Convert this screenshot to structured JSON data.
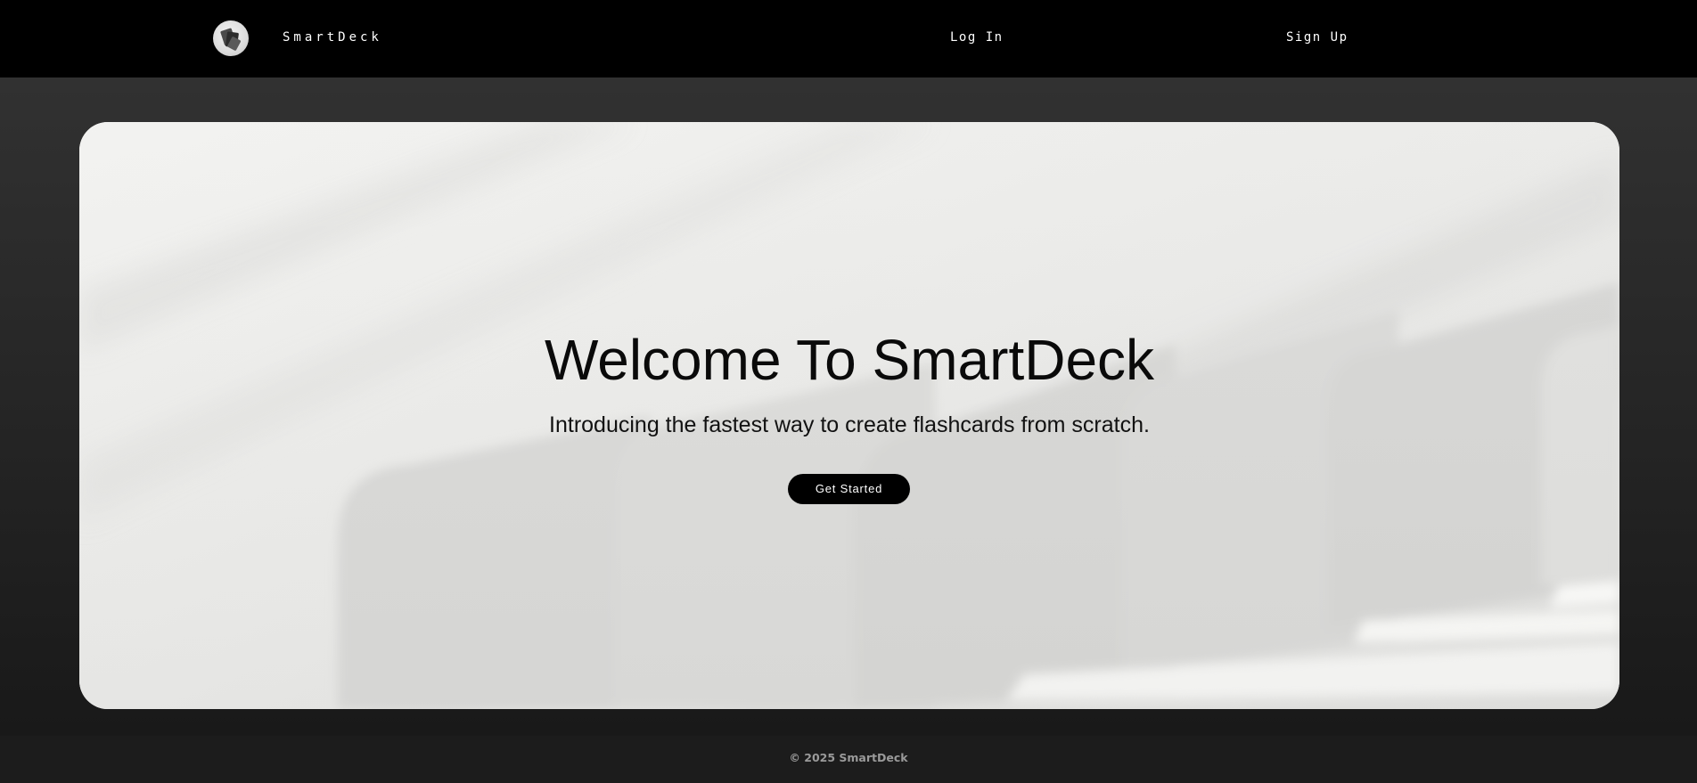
{
  "navbar": {
    "logo_icon": "card-deck-logo-icon",
    "brand": "SmartDeck",
    "login_label": "Log In",
    "signup_label": "Sign Up"
  },
  "hero": {
    "title": "Welcome To SmartDeck",
    "subtitle": "Introducing the fastest way to create flashcards from scratch.",
    "cta_label": "Get Started"
  },
  "footer": {
    "copyright": "© 2025 SmartDeck"
  },
  "colors": {
    "navbar_bg": "#000000",
    "page_bg": "#262626",
    "hero_bg": "#eeeeec",
    "cta_bg": "#000000",
    "footer_bg": "#1c1c1c",
    "footer_text": "#9a9a9a"
  }
}
